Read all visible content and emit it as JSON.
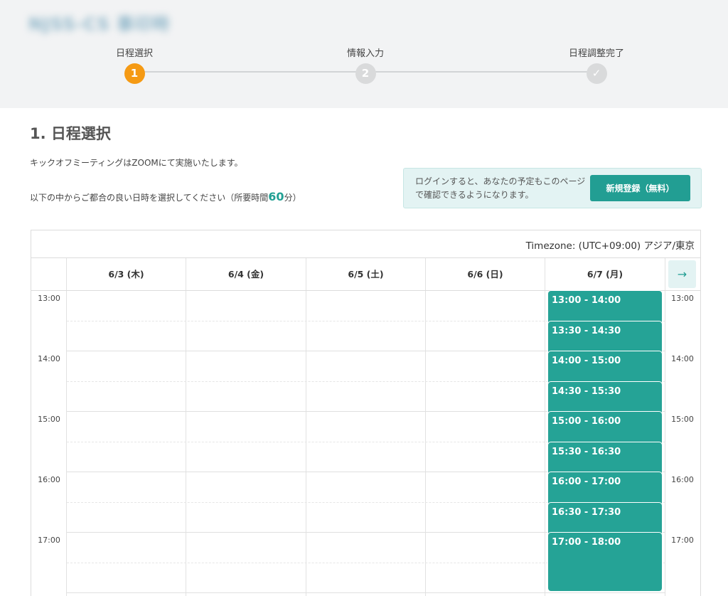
{
  "header": {
    "company_name": "NJSS-CS 事印時",
    "steps": [
      {
        "label": "日程選択",
        "number": "1",
        "state": "active"
      },
      {
        "label": "情報入力",
        "number": "2",
        "state": "inactive"
      },
      {
        "label": "日程調整完了",
        "number": "✓",
        "state": "inactive"
      }
    ]
  },
  "main": {
    "title": "1. 日程選択",
    "description": "キックオフミーティングはZOOMにて実施いたします。",
    "instruction": "以下の中からご都合の良い日時を選択してください（所要時間",
    "duration": "60",
    "duration_unit": "分）"
  },
  "login_notice": {
    "text": "ログインすると、あなたの予定もこのページで確認できるようになります。",
    "signup_label": "新規登録（無料）"
  },
  "calendar": {
    "timezone": "Timezone: (UTC+09:00) アジア/東京",
    "days": [
      "6/3 (木)",
      "6/4 (金)",
      "6/5 (土)",
      "6/6 (日)",
      "6/7 (月)"
    ],
    "next_label": "→",
    "hours": [
      "13:00",
      "14:00",
      "15:00",
      "16:00",
      "17:00"
    ],
    "slots": [
      "13:00 - 14:00",
      "13:30 - 14:30",
      "14:00 - 15:00",
      "14:30 - 15:30",
      "15:00 - 16:00",
      "15:30 - 16:30",
      "16:00 - 17:00",
      "16:30 - 17:30",
      "17:00 - 18:00"
    ]
  },
  "colors": {
    "accent": "#229e93",
    "active_step": "#f59a14"
  }
}
